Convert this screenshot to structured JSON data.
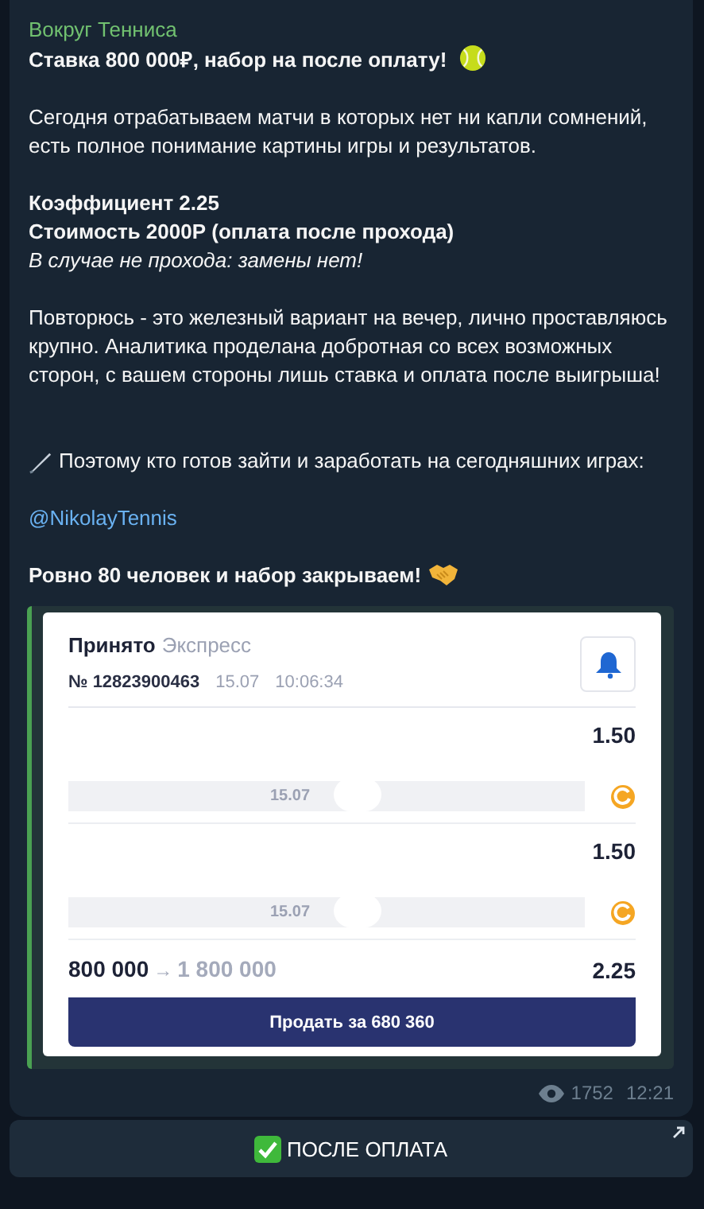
{
  "message": {
    "channel": "Вокруг Тенниса",
    "blocks": [
      {
        "lines": [
          {
            "kind": "headline",
            "text": "Ставка 800 000₽, набор на после оплату!"
          }
        ]
      },
      {
        "lines": [
          {
            "kind": "plain",
            "text": "Сегодня отрабатываем матчи в которых нет ни капли сомнений, есть полное понимание картины игры и результатов."
          }
        ]
      },
      {
        "lines": [
          {
            "kind": "bold",
            "text": "Коэффициент 2.25"
          },
          {
            "kind": "bold",
            "text": "Стоимость 2000Р (оплата после прохода)"
          },
          {
            "kind": "italic",
            "text": "В случае не прохода: замены нет!"
          }
        ]
      },
      {
        "lines": [
          {
            "kind": "plain",
            "text": "Повторюсь - это железный вариант на вечер, лично проставляюсь крупно. Аналитика проделана добротная со всех возможных сторон, с вашем стороны лишь ставка и оплата после выигрыша!"
          }
        ]
      },
      {
        "lines": [
          {
            "kind": "lead",
            "text": "Поэтому кто готов зайти и заработать на сегодняшних играх:"
          }
        ]
      },
      {
        "lines": [
          {
            "kind": "link",
            "text": "@NikolayTennis"
          }
        ]
      },
      {
        "lines": [
          {
            "kind": "closing",
            "text": "Ровно 80 человек и набор закрываем!"
          }
        ]
      }
    ],
    "slip": {
      "status": "Принято",
      "type": "Экспресс",
      "number": "№ 12823900463",
      "date": "15.07",
      "time": "10:06:34",
      "legs": [
        {
          "odds": "1.50",
          "date": "15.07"
        },
        {
          "odds": "1.50",
          "date": "15.07"
        }
      ],
      "stake": "800 000",
      "arrow": "→",
      "payout": "1 800 000",
      "total_odds": "2.25",
      "sell_button": "Продать за 680 360"
    },
    "views": "1752",
    "time": "12:21"
  },
  "buttons": [
    {
      "label": "ПОСЛЕ ОПЛАТА"
    }
  ]
}
